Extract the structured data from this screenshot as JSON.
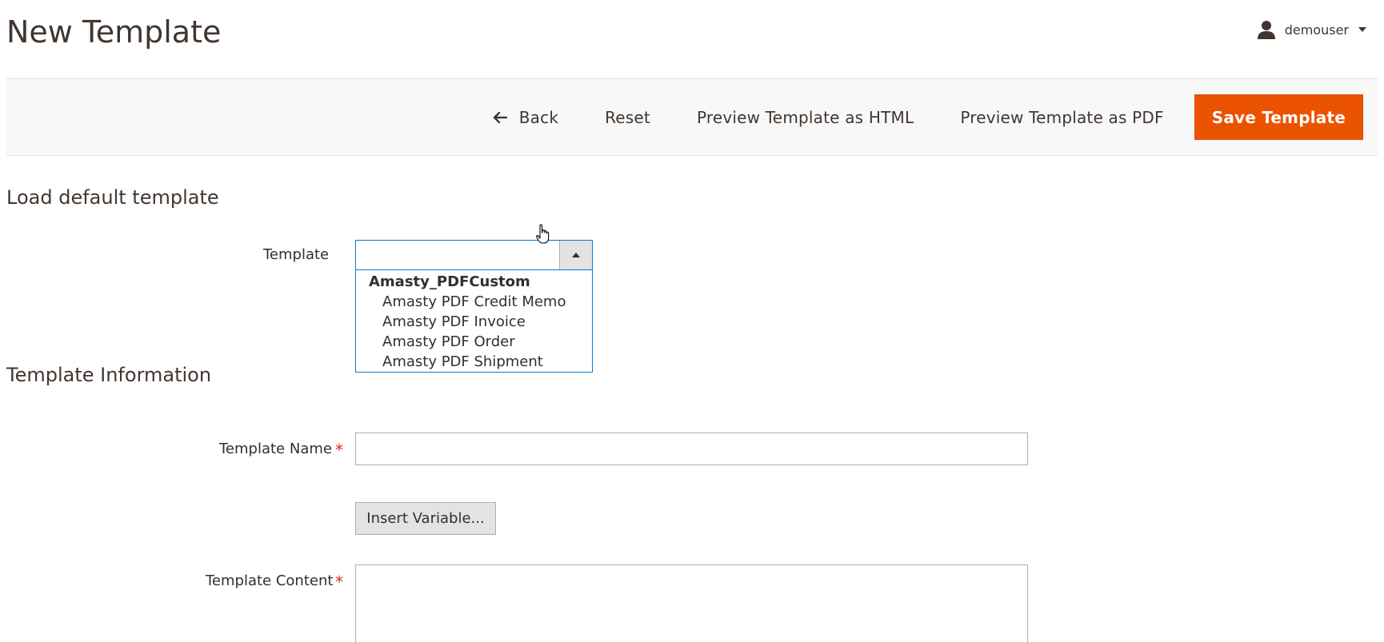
{
  "header": {
    "page_title": "New Template",
    "user_name": "demouser"
  },
  "actions": {
    "back_label": "Back",
    "reset_label": "Reset",
    "preview_html_label": "Preview Template as HTML",
    "preview_pdf_label": "Preview Template as PDF",
    "save_label": "Save Template"
  },
  "load_default": {
    "section_title": "Load default template",
    "template_label": "Template",
    "selected_value": "",
    "dropdown": {
      "group_label": "Amasty_PDFCustom",
      "options": [
        "Amasty PDF Credit Memo",
        "Amasty PDF Invoice",
        "Amasty PDF Order",
        "Amasty PDF Shipment"
      ]
    }
  },
  "template_info": {
    "section_title": "Template Information",
    "name_label": "Template Name",
    "name_value": "",
    "insert_variable_label": "Insert Variable...",
    "content_label": "Template Content",
    "content_value": "",
    "required_mark": "*"
  },
  "colors": {
    "primary_button": "#eb5202",
    "focus_border": "#007bdb",
    "required": "#e22626"
  }
}
